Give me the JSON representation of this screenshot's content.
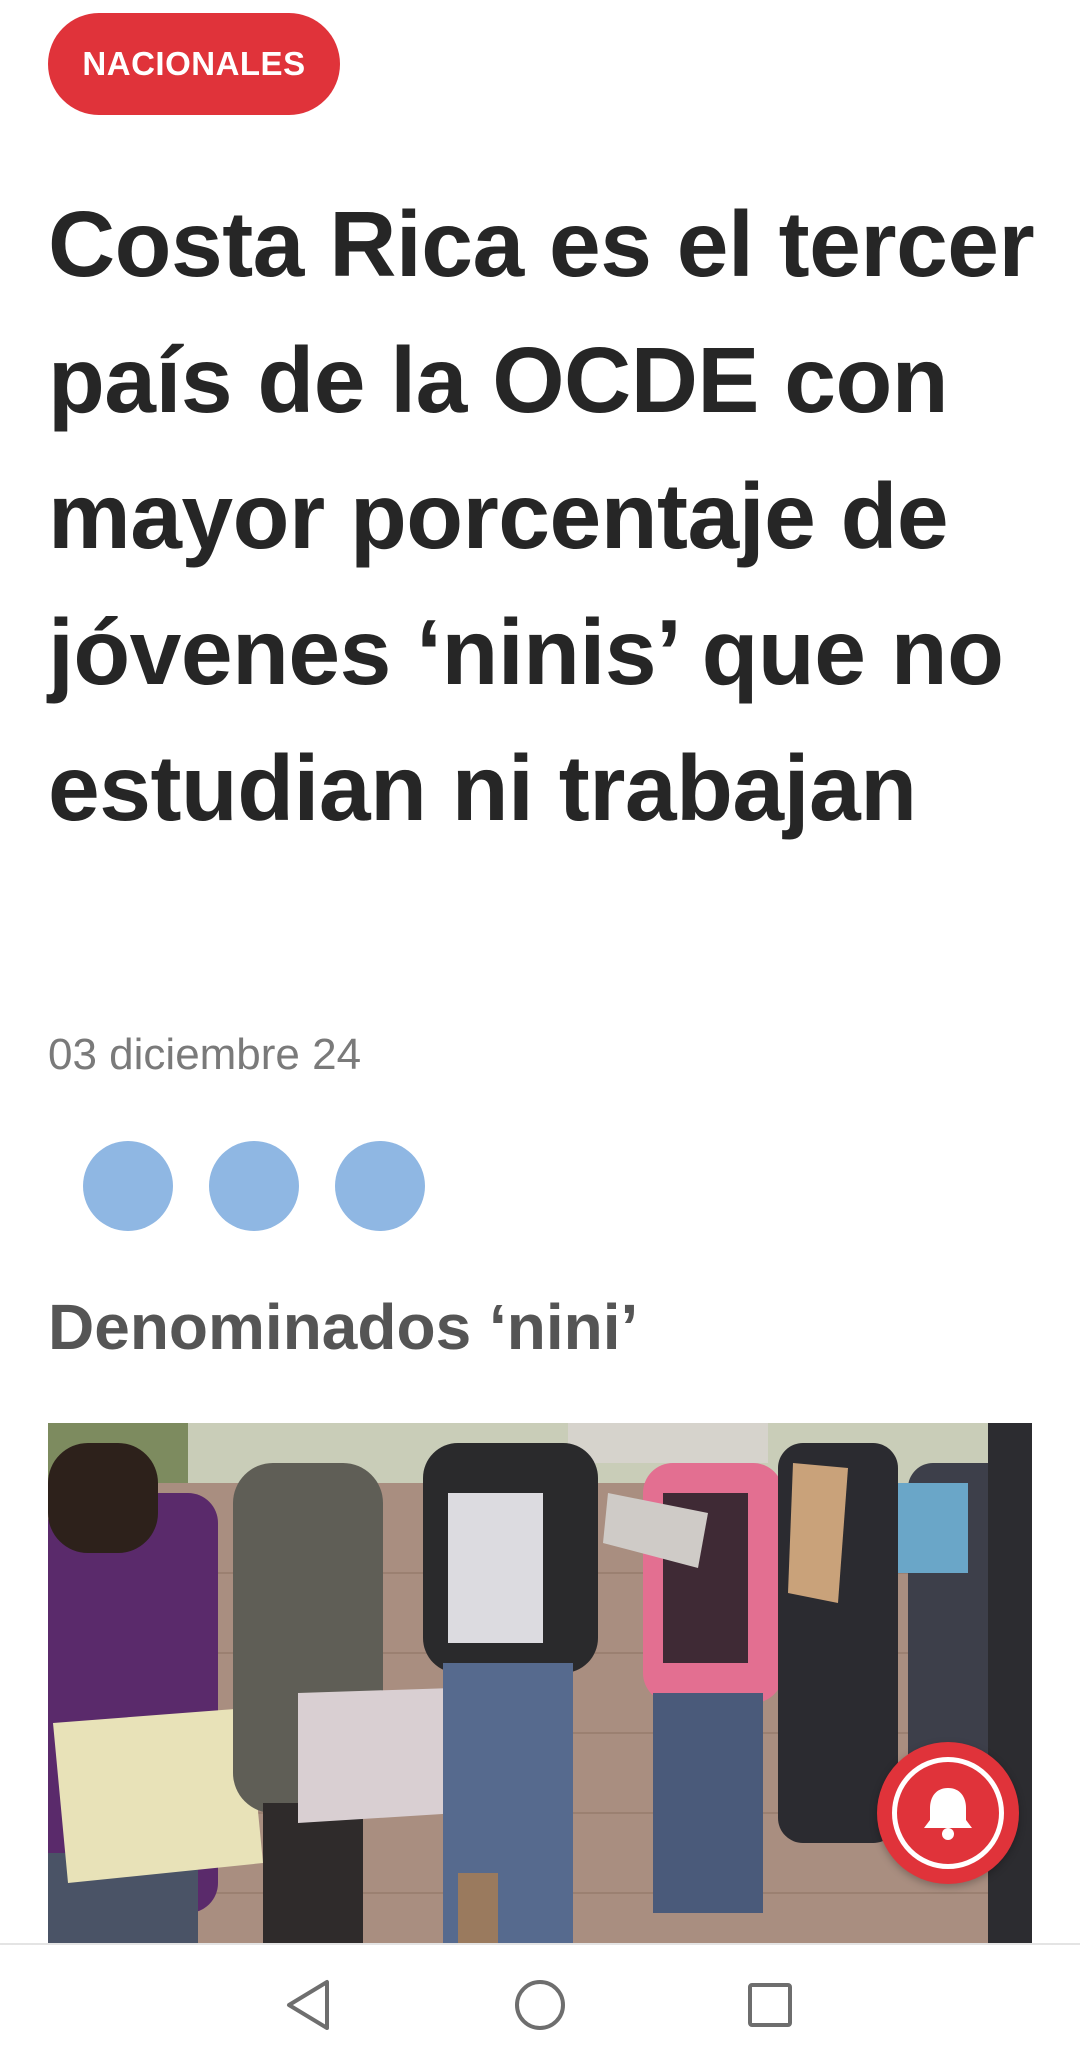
{
  "article": {
    "category": "NACIONALES",
    "headline": "Costa Rica es el tercer país de la OCDE con mayor porcentaje de jóvenes ‘ninis’ que no estudian ni trabajan",
    "date": "03 diciembre 24",
    "subheading": "Denominados ‘nini’"
  },
  "share": {
    "buttons": [
      "share-button",
      "share-button",
      "share-button"
    ],
    "color": "#8fb7e3"
  },
  "notification_button": {
    "icon": "bell-icon",
    "color": "#e0333a"
  },
  "system_nav": {
    "back_icon": "back-triangle-icon",
    "home_icon": "home-circle-icon",
    "recents_icon": "recents-square-icon"
  },
  "colors": {
    "accent": "#e0333a",
    "headline": "#262626",
    "date": "#7a7a7a",
    "subheading": "#555555"
  }
}
